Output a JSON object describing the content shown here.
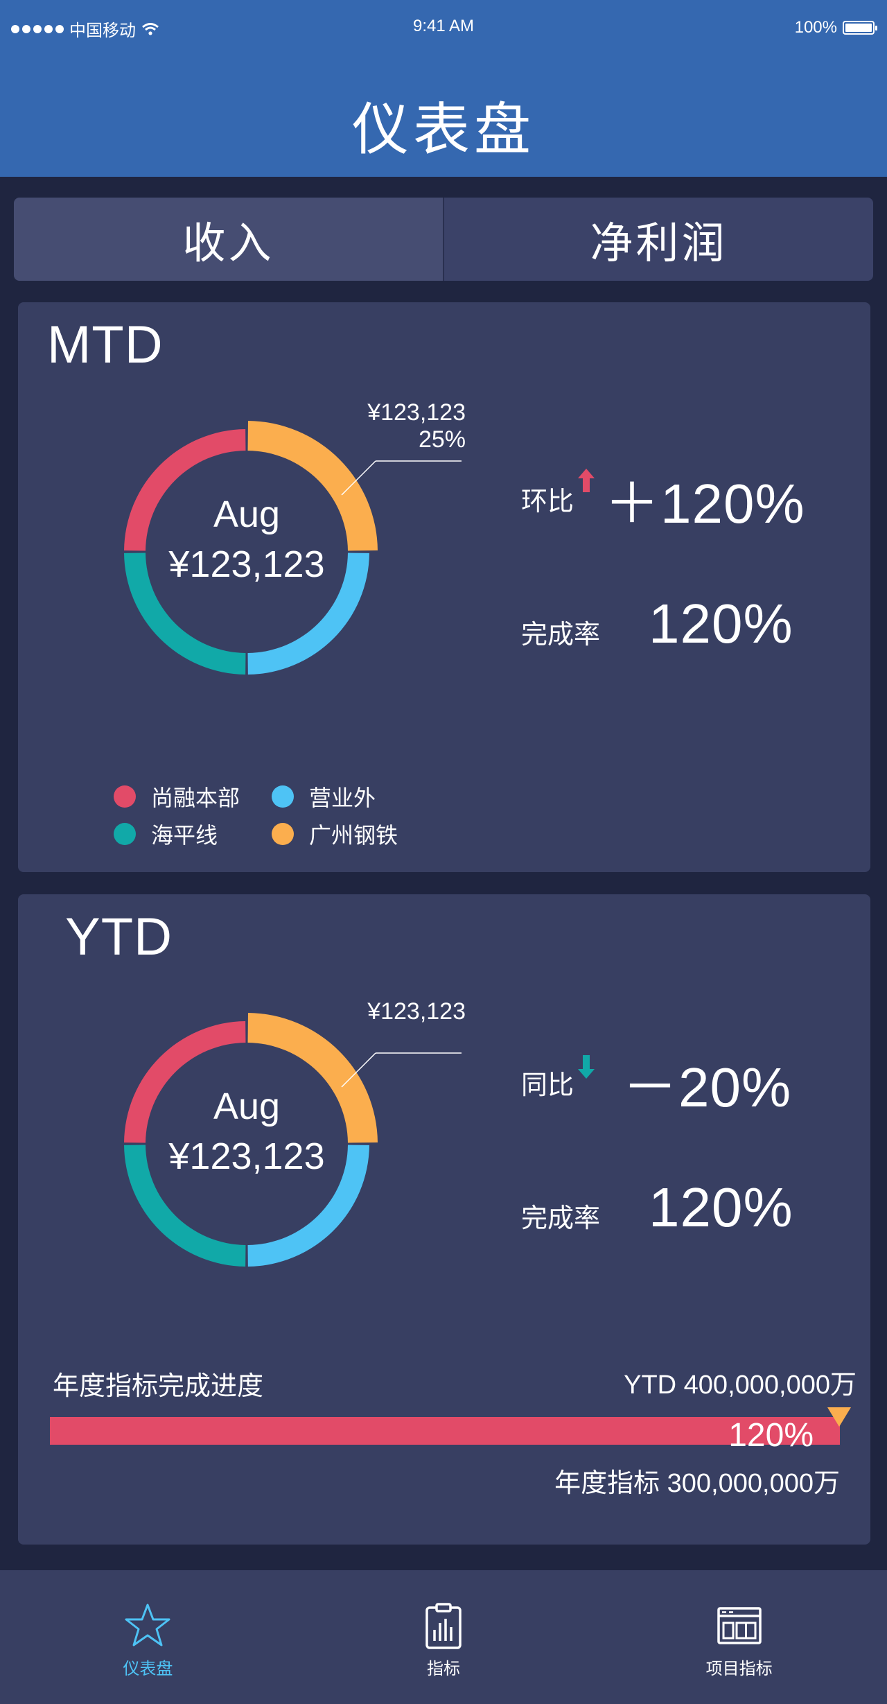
{
  "status_bar": {
    "carrier": "中国移动",
    "time": "9:41 AM",
    "battery": "100%"
  },
  "header": {
    "title": "仪表盘"
  },
  "tabs": [
    {
      "label": "收入",
      "active": true
    },
    {
      "label": "净利润",
      "active": false
    }
  ],
  "colors": {
    "red": "#e24b68",
    "cyan": "#4ec3f5",
    "teal": "#11a9a8",
    "orange": "#fbae4e",
    "header_blue": "#3568b0"
  },
  "mtd": {
    "title": "MTD",
    "center_month": "Aug",
    "center_value": "¥123,123",
    "callout_value": "¥123,123",
    "callout_percent": "25%",
    "metric1_label": "环比",
    "metric1_trend": "up",
    "metric1_value": "＋120%",
    "metric2_label": "完成率",
    "metric2_value": "120%",
    "legend": [
      {
        "label": "尚融本部",
        "color": "#e24b68"
      },
      {
        "label": "营业外",
        "color": "#4ec3f5"
      },
      {
        "label": "海平线",
        "color": "#11a9a8"
      },
      {
        "label": "广州钢铁",
        "color": "#fbae4e"
      }
    ]
  },
  "ytd": {
    "title": "YTD",
    "center_month": "Aug",
    "center_value": "¥123,123",
    "callout_value": "¥123,123",
    "metric1_label": "同比",
    "metric1_trend": "down",
    "metric1_value": "－20%",
    "metric2_label": "完成率",
    "metric2_value": "120%",
    "progress": {
      "label": "年度指标完成进度",
      "ytd_value": "YTD  400,000,000万",
      "percent_label": "120%",
      "completion": 1.2,
      "target": "年度指标 300,000,000万"
    }
  },
  "tabbar": [
    {
      "label": "仪表盘",
      "icon": "star-icon",
      "active": true
    },
    {
      "label": "指标",
      "icon": "clipboard-chart-icon",
      "active": false
    },
    {
      "label": "项目指标",
      "icon": "browser-window-icon",
      "active": false
    }
  ],
  "chart_data": [
    {
      "type": "pie",
      "title": "MTD",
      "categories": [
        "广州钢铁",
        "营业外",
        "海平线",
        "尚融本部"
      ],
      "values": [
        25,
        25,
        25,
        25
      ],
      "colors": [
        "#fbae4e",
        "#4ec3f5",
        "#11a9a8",
        "#e24b68"
      ]
    },
    {
      "type": "pie",
      "title": "YTD",
      "categories": [
        "广州钢铁",
        "营业外",
        "海平线",
        "尚融本部"
      ],
      "values": [
        25,
        25,
        25,
        25
      ],
      "colors": [
        "#fbae4e",
        "#4ec3f5",
        "#11a9a8",
        "#e24b68"
      ]
    }
  ]
}
